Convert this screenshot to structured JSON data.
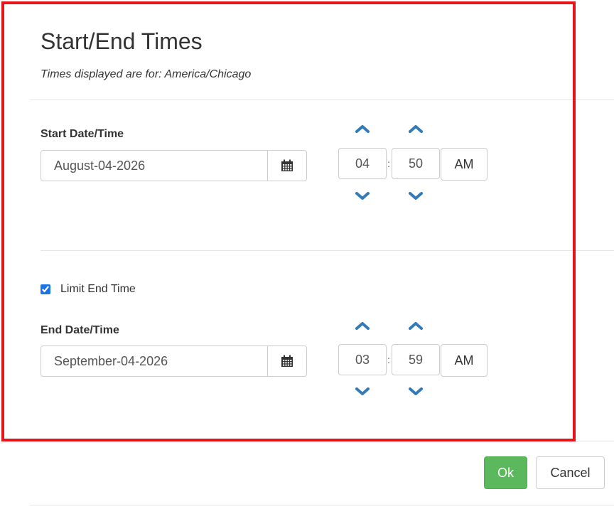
{
  "dialog": {
    "title": "Start/End Times",
    "subtitle": "Times displayed are for: America/Chicago"
  },
  "start": {
    "label": "Start Date/Time",
    "date": "August-04-2026",
    "hour": "04",
    "minute": "50",
    "separator": ":",
    "ampm": "AM"
  },
  "limit_end": {
    "label": "Limit End Time",
    "checked": true
  },
  "end": {
    "label": "End Date/Time",
    "date": "September-04-2026",
    "hour": "03",
    "minute": "59",
    "separator": ":",
    "ampm": "AM"
  },
  "footer": {
    "ok_label": "Ok",
    "cancel_label": "Cancel"
  },
  "colors": {
    "highlight": "#e8141c",
    "ok_button": "#5cb85c",
    "chevron": "#337ab7",
    "checkbox": "#1a73e8"
  },
  "icons": {
    "calendar": "calendar-icon",
    "increment": "chevron-up-icon",
    "decrement": "chevron-down-icon"
  }
}
